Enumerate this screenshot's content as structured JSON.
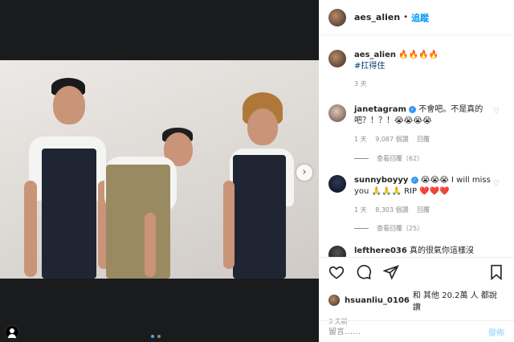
{
  "post": {
    "username": "aes_alien",
    "follow_label": "追蹤",
    "separator": "•",
    "caption_emoji": "🔥🔥🔥🔥",
    "caption_hashtag": "#扛得住",
    "caption_time": "3 天",
    "photo_pager": {
      "current": 1,
      "total": 2
    }
  },
  "comments": [
    {
      "username": "janetagram",
      "text": "不會吧。不是真的吧？！？！😭😭😭😭",
      "time": "1 天",
      "likes": "9,087 個讚",
      "reply_label": "回覆",
      "view_replies": "查看回覆（62）"
    },
    {
      "username": "sunnyboyyy",
      "text": "😭😭😭 I will miss you 🙏🙏🙏 RIP ❤️❤️❤️",
      "time": "1 天",
      "likes": "8,303 個讚",
      "reply_label": "回覆",
      "view_replies": "查看回覆（25）"
    },
    {
      "username": "lefthere036",
      "text": "真的很氣你這樣沒"
    }
  ],
  "likes": {
    "user": "hsuanliu_0106",
    "text": "和 其他 20.2萬 人 都說讚"
  },
  "post_time": "3 天前",
  "comment_box": {
    "placeholder": "留言……",
    "post_label": "發佈"
  },
  "colors": {
    "accent": "#0095f6",
    "muted": "#8e8e8e",
    "verified": "#3897f0"
  }
}
